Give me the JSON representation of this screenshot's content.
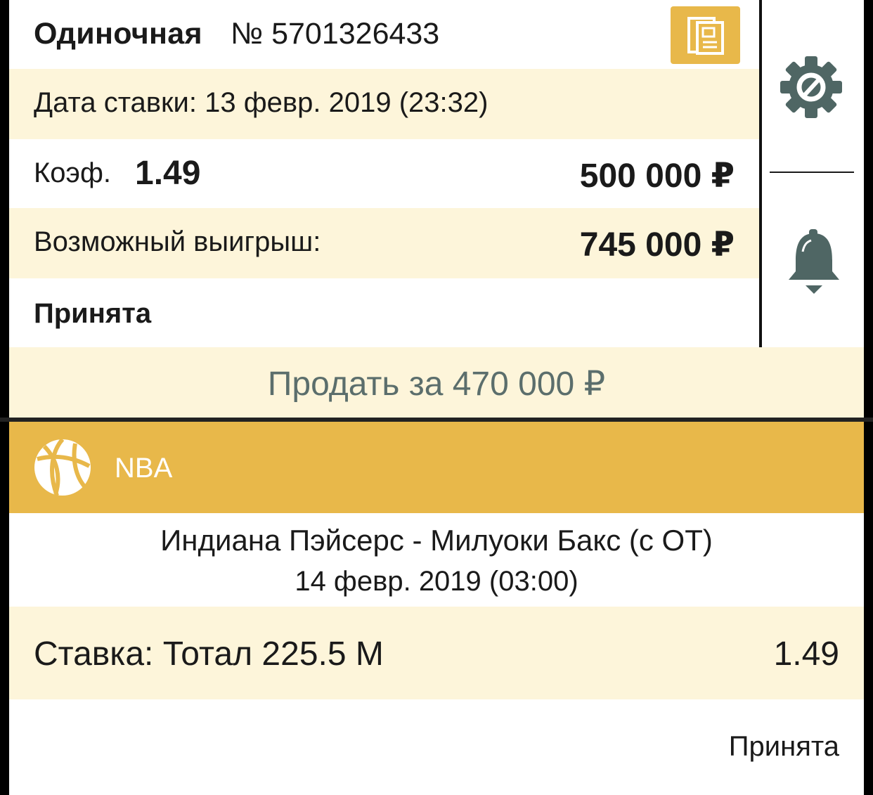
{
  "header": {
    "bet_type": "Одиночная",
    "bet_number": "№ 5701326433",
    "doc_icon": "document-icon"
  },
  "details": {
    "date_label": "Дата ставки: 13 февр. 2019 (23:32)",
    "coef_label": "Коэф.",
    "coef_value": "1.49",
    "stake": "500 000 ₽",
    "win_label": "Возможный выигрыш:",
    "win_value": "745 000 ₽",
    "status": "Принята"
  },
  "side": {
    "settings_icon": "gear-icon",
    "notify_icon": "bell-icon"
  },
  "sell": {
    "label": "Продать за 470 000 ₽"
  },
  "event": {
    "league_icon": "basketball-icon",
    "league": "NBA",
    "match": "Индиана Пэйсерс - Милуоки Бакс (с ОТ)",
    "date": "14 февр. 2019 (03:00)",
    "bet_label": "Ставка: Тотал 225.5 М",
    "bet_odds": "1.49",
    "status": "Принята"
  },
  "colors": {
    "accent": "#e8b84a",
    "cream": "#fdf5da",
    "icon_gray": "#4f6664",
    "sell_text": "#5b6e6c"
  }
}
